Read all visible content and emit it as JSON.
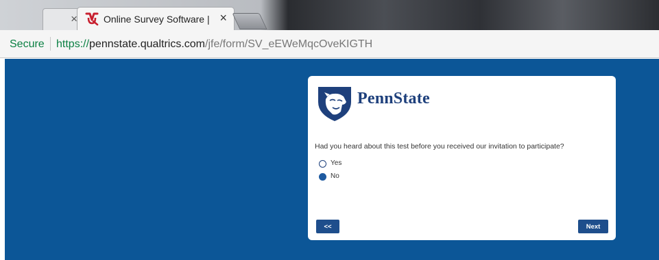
{
  "browser": {
    "tabs": [
      {
        "label": "",
        "close": "×"
      },
      {
        "label": "Online Survey Software |",
        "close": "×"
      }
    ],
    "address": {
      "secure_label": "Secure",
      "url_scheme": "https://",
      "url_host": "pennstate.qualtrics.com",
      "url_path": "/jfe/form/SV_eEWeMqcOveKIGTH"
    }
  },
  "survey": {
    "logo_text": "PennState",
    "question": "Had you heard about this test before you received our invitation to participate?",
    "choices": [
      {
        "label": "Yes",
        "selected": false
      },
      {
        "label": "No",
        "selected": true
      }
    ],
    "back_label": "<<",
    "next_label": "Next"
  },
  "colors": {
    "page_background": "#0c5697",
    "brand_navy": "#1e407c",
    "button": "#1e4e8c",
    "secure_green": "#0b8043"
  }
}
